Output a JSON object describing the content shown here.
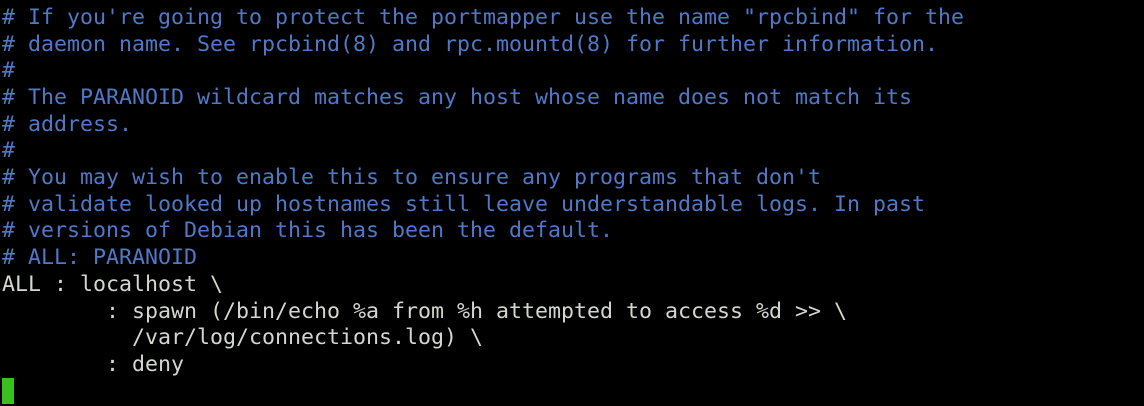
{
  "editor": {
    "lines": [
      {
        "kind": "comment",
        "text": "# If you're going to protect the portmapper use the name \"rpcbind\" for the"
      },
      {
        "kind": "comment",
        "text": "# daemon name. See rpcbind(8) and rpc.mountd(8) for further information."
      },
      {
        "kind": "comment",
        "text": "#"
      },
      {
        "kind": "comment",
        "text": "# The PARANOID wildcard matches any host whose name does not match its"
      },
      {
        "kind": "comment",
        "text": "# address."
      },
      {
        "kind": "comment",
        "text": "#"
      },
      {
        "kind": "comment",
        "text": "# You may wish to enable this to ensure any programs that don't"
      },
      {
        "kind": "comment",
        "text": "# validate looked up hostnames still leave understandable logs. In past"
      },
      {
        "kind": "comment",
        "text": "# versions of Debian this has been the default."
      },
      {
        "kind": "comment",
        "text": "# ALL: PARANOID"
      },
      {
        "kind": "code",
        "text": "ALL : localhost \\"
      },
      {
        "kind": "code",
        "text": "        : spawn (/bin/echo %a from %h attempted to access %d >> \\"
      },
      {
        "kind": "code",
        "text": "          /var/log/connections.log) \\"
      },
      {
        "kind": "code",
        "text": "        : deny"
      }
    ],
    "colors": {
      "background": "#000000",
      "comment": "#4f79c8",
      "code": "#d3d7cf",
      "cursor": "#3bbf1e"
    }
  }
}
